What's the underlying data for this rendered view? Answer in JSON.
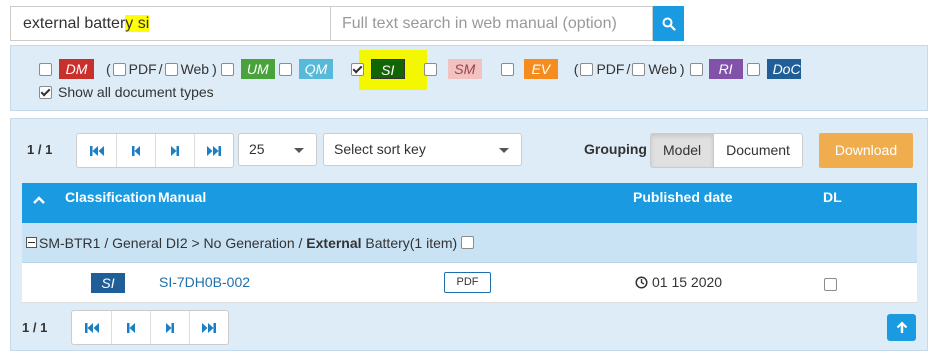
{
  "search": {
    "keyword_value_a": "external batter",
    "keyword_value_b": "y si",
    "fulltext_placeholder": "Full text search in web manual (option)"
  },
  "filters": {
    "dm": "DM",
    "pdf": "PDF",
    "web": "Web",
    "um": "UM",
    "qm": "QM",
    "si": "SI",
    "sm": "SM",
    "ev": "EV",
    "ri": "RI",
    "doc": "DoC",
    "open_paren": "(",
    "close_paren": ")",
    "slash": "/",
    "show_all": "Show all document types"
  },
  "results": {
    "count_top": "1 / 1",
    "count_bottom": "1 / 1",
    "per_page": "25",
    "sort_placeholder": "Select sort key",
    "grouping_label": "Grouping",
    "grouping_model": "Model",
    "grouping_document": "Document",
    "download": "Download"
  },
  "table": {
    "col_classification": "Classification",
    "col_manual": "Manual",
    "col_published": "Published date",
    "col_dl": "DL",
    "group_prefix": "SM-BTR1 / General DI2 > No Generation / ",
    "group_bold": "External",
    "group_suffix": " Battery(1 item)",
    "rows": [
      {
        "classification": "SI",
        "manual": "SI-7DH0B-002",
        "format": "PDF",
        "date": "01 15 2020"
      }
    ]
  },
  "colors": {
    "header_blue": "#1a9ae0",
    "panel_bg": "#ddecf7",
    "download_orange": "#f0ad4e",
    "highlight_yellow": "#f3f700"
  }
}
